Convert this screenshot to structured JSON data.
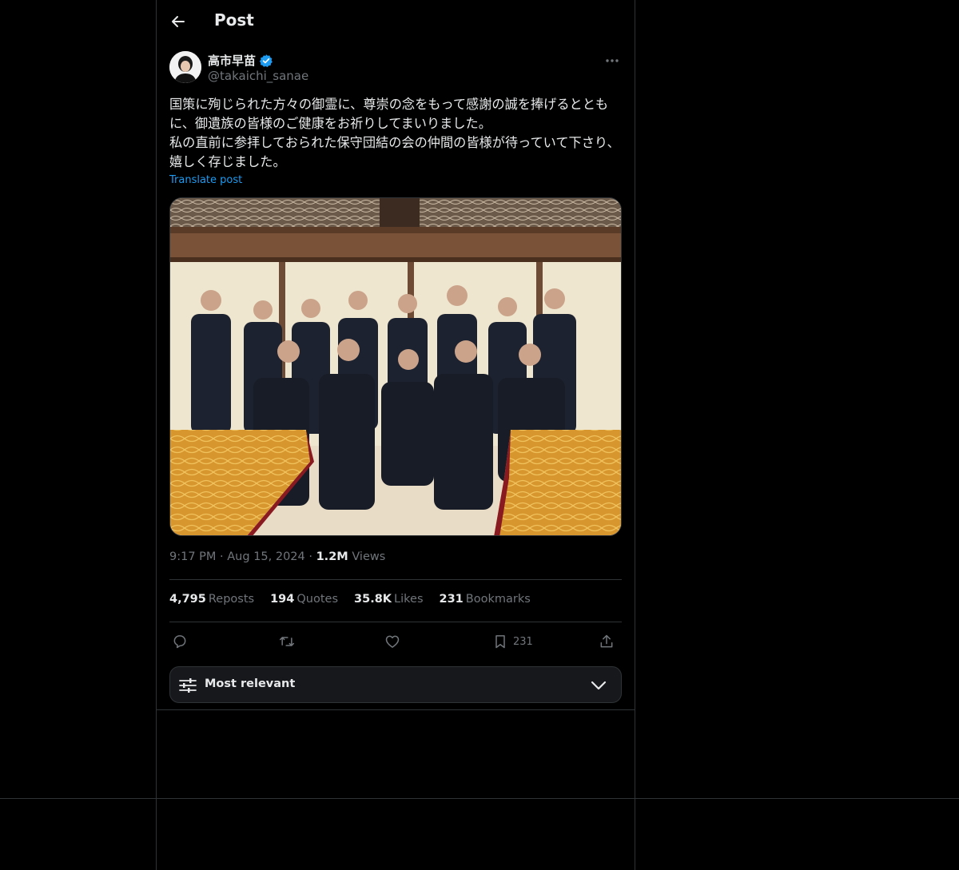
{
  "header": {
    "title": "Post"
  },
  "author": {
    "name": "高市早苗",
    "handle": "@takaichi_sanae",
    "verified": true
  },
  "post": {
    "text": "国策に殉じられた方々の御霊に、尊崇の念をもって感謝の誠を捧げるとともに、御遺族の皆様のご健康をお祈りしてまいりました。\n私の直前に参拝しておられた保守団結の会の仲間の皆様が待っていて下さり、嬉しく存じました。",
    "translate_label": "Translate post",
    "time": "9:17 PM",
    "date": "Aug 15, 2024",
    "views_count": "1.2M",
    "views_label": "Views",
    "dot": "·"
  },
  "stats": {
    "reposts_count": "4,795",
    "reposts_label": "Reposts",
    "quotes_count": "194",
    "quotes_label": "Quotes",
    "likes_count": "35.8K",
    "likes_label": "Likes",
    "bookmarks_count": "231",
    "bookmarks_label": "Bookmarks"
  },
  "actions": {
    "bookmark_count": "231"
  },
  "sort": {
    "label": "Most relevant"
  },
  "colors": {
    "accent": "#1d9bf0",
    "muted": "#71767b",
    "border": "#2f3336",
    "text": "#e7e9ea"
  },
  "icons": [
    "back-arrow-icon",
    "verified-badge-icon",
    "more-icon",
    "reply-icon",
    "repost-icon",
    "like-icon",
    "bookmark-icon",
    "share-icon",
    "sliders-icon",
    "chevron-down-icon"
  ]
}
